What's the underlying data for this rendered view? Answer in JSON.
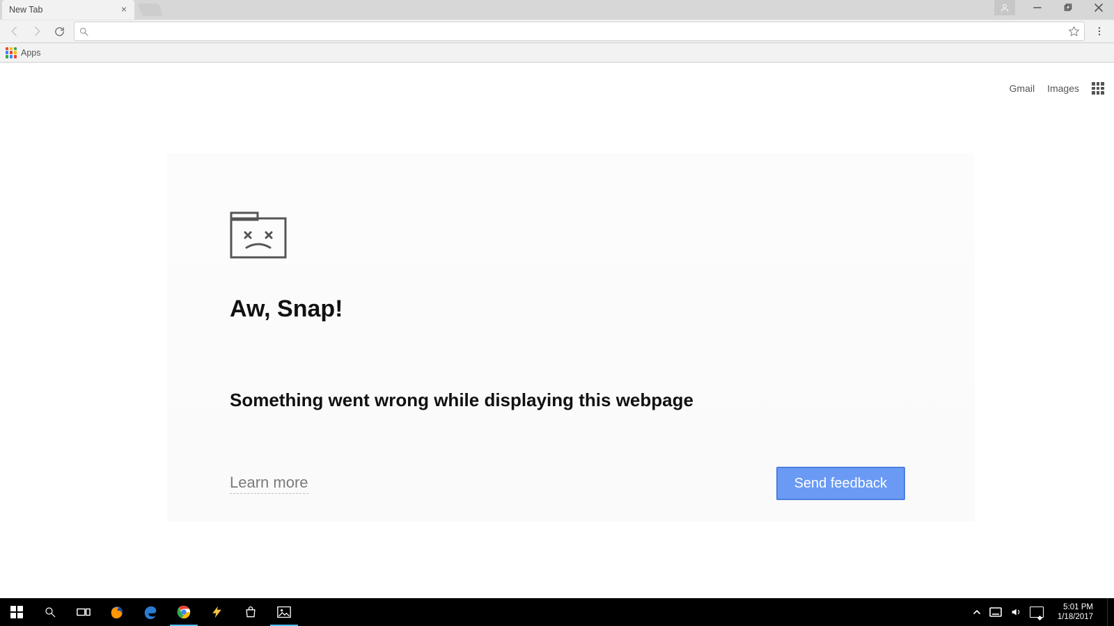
{
  "tab": {
    "title": "New Tab"
  },
  "bookmarks": {
    "apps_label": "Apps"
  },
  "omnibox": {
    "value": "",
    "placeholder": ""
  },
  "google_links": {
    "gmail": "Gmail",
    "images": "Images"
  },
  "error": {
    "title": "Aw, Snap!",
    "message": "Something went wrong while displaying this webpage",
    "learn_more": "Learn more",
    "send_feedback": "Send feedback"
  },
  "tray": {
    "time": "5:01 PM",
    "date": "1/18/2017"
  }
}
